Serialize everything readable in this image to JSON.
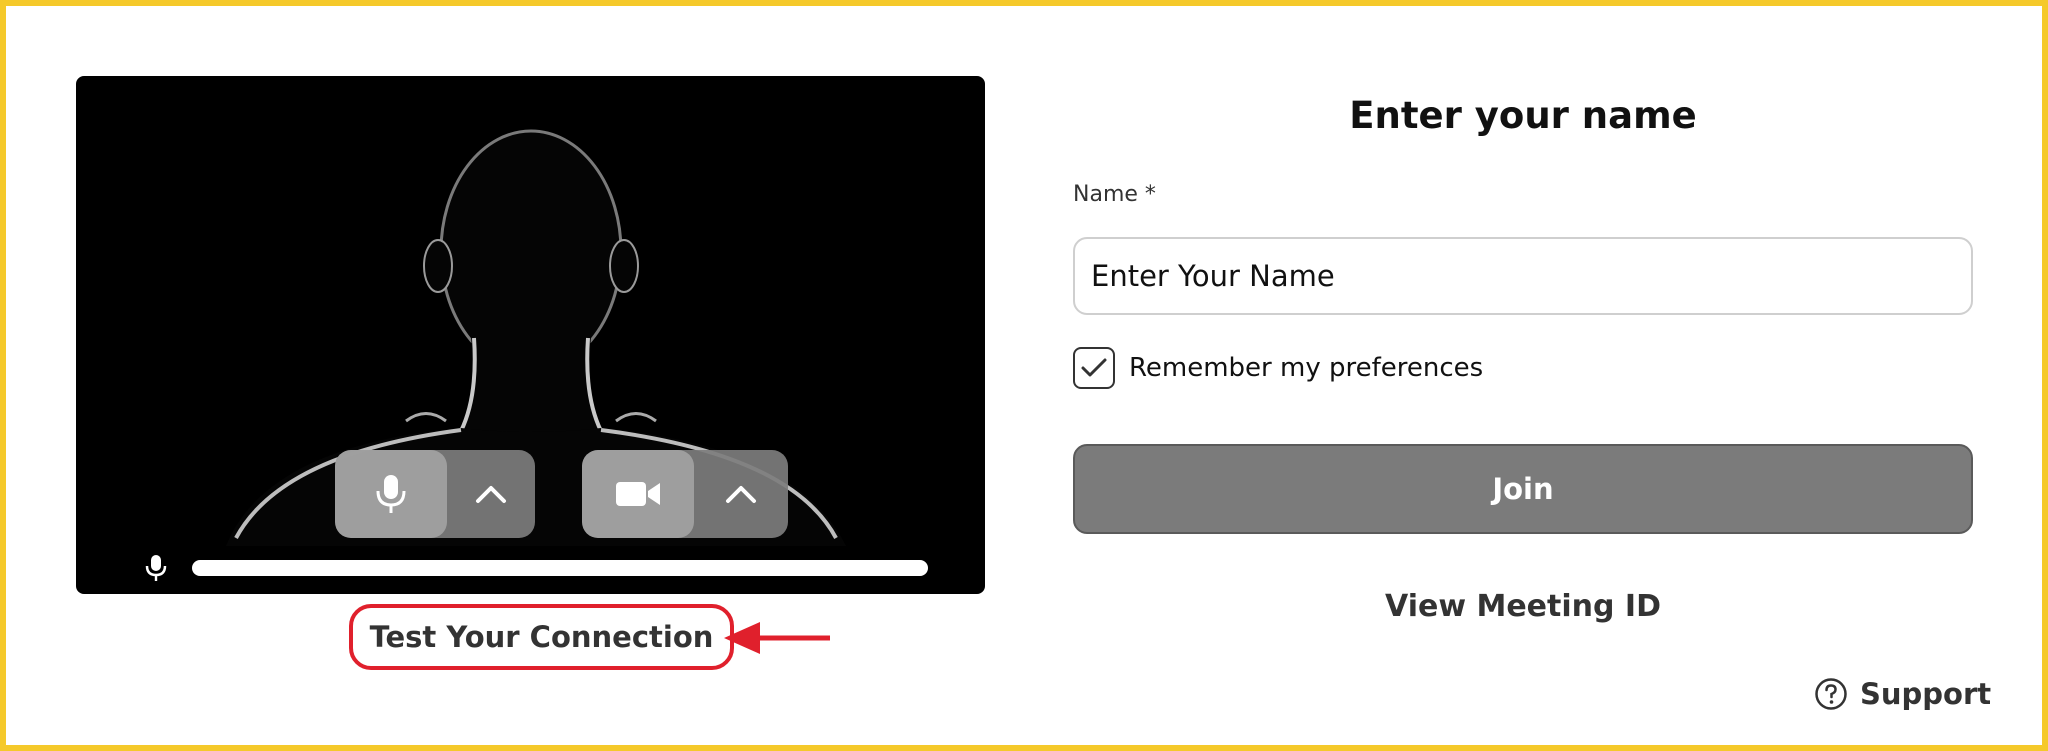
{
  "video": {
    "mic_button": "microphone-toggle",
    "mic_options": "chevron-up",
    "camera_button": "camera-toggle",
    "camera_options": "chevron-up",
    "audio_level": 1.0
  },
  "test_connection": {
    "label": "Test Your Connection"
  },
  "form": {
    "title": "Enter your name",
    "name_label": "Name *",
    "name_placeholder": "Enter Your Name",
    "remember_checked": true,
    "remember_label": "Remember my preferences",
    "join_label": "Join",
    "view_meeting_label": "View Meeting ID"
  },
  "support": {
    "label": "Support"
  },
  "colors": {
    "frame": "#f5c92a",
    "annotation": "#e0202c",
    "join_bg": "#7b7b7b"
  }
}
